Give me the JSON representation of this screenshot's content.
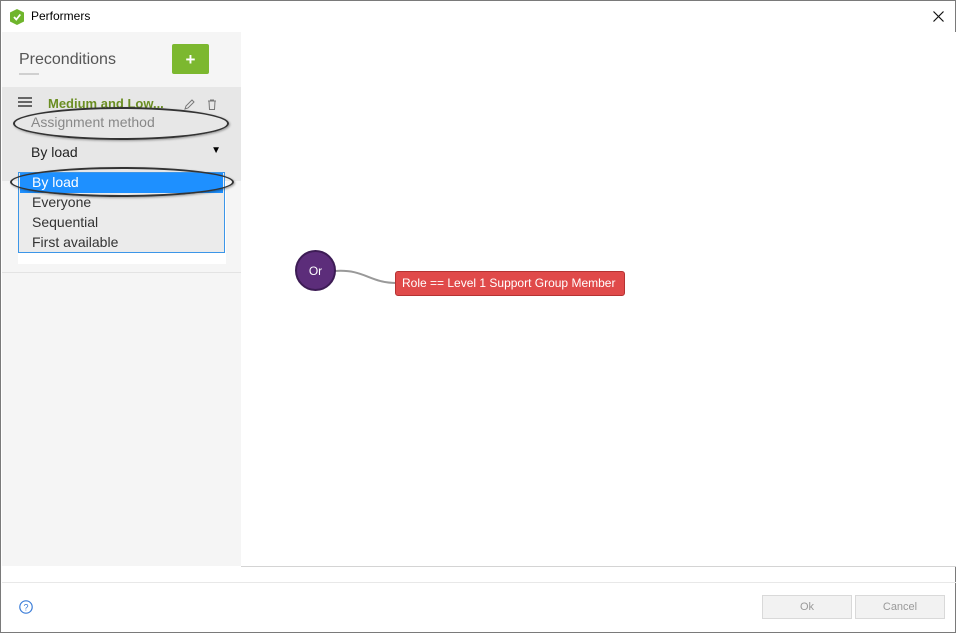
{
  "window": {
    "title": "Performers"
  },
  "sidebar": {
    "title": "Preconditions",
    "add_label": "+",
    "card": {
      "name": "Medium and Low...",
      "assignment_label": "Assignment method",
      "selected_value": "By load",
      "options": [
        "By load",
        "Everyone",
        "Sequential",
        "First available"
      ]
    }
  },
  "canvas": {
    "or_node_label": "Or",
    "role_node_label": "Role == Level 1 Support Group Member"
  },
  "footer": {
    "ok_label": "Ok",
    "cancel_label": "Cancel"
  },
  "colors": {
    "add_button": "#7cb82f",
    "or_node": "#5c2d7a",
    "role_node": "#e04a4a",
    "selected_option": "#1e90ff"
  }
}
